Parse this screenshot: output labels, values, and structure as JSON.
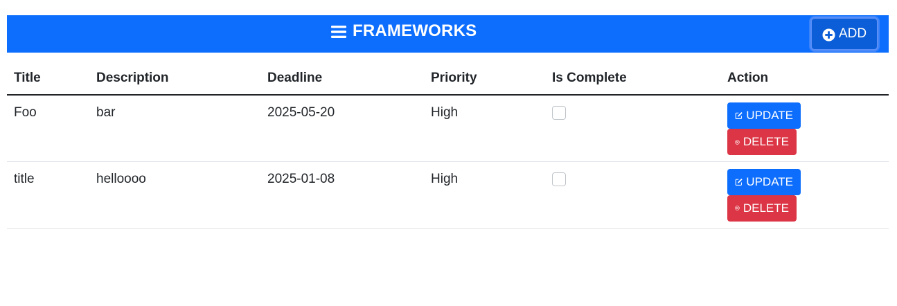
{
  "header": {
    "title": "FRAMEWORKS",
    "add_label": "ADD",
    "background": "#0d6efd"
  },
  "table": {
    "columns": [
      "Title",
      "Description",
      "Deadline",
      "Priority",
      "Is Complete",
      "Action"
    ],
    "rows": [
      {
        "title": "Foo",
        "description": "bar",
        "deadline": "2025-05-20",
        "priority": "High",
        "is_complete": false,
        "update_label": "UPDATE",
        "delete_label": "DELETE"
      },
      {
        "title": "title",
        "description": "helloooo",
        "deadline": "2025-01-08",
        "priority": "High",
        "is_complete": false,
        "update_label": "UPDATE",
        "delete_label": "DELETE"
      }
    ]
  },
  "icons": {
    "menu": "menu-icon",
    "add": "plus-circle-icon",
    "update": "edit-icon",
    "delete": "x-circle-icon"
  },
  "colors": {
    "primary": "#0d6efd",
    "danger": "#dc3545"
  }
}
